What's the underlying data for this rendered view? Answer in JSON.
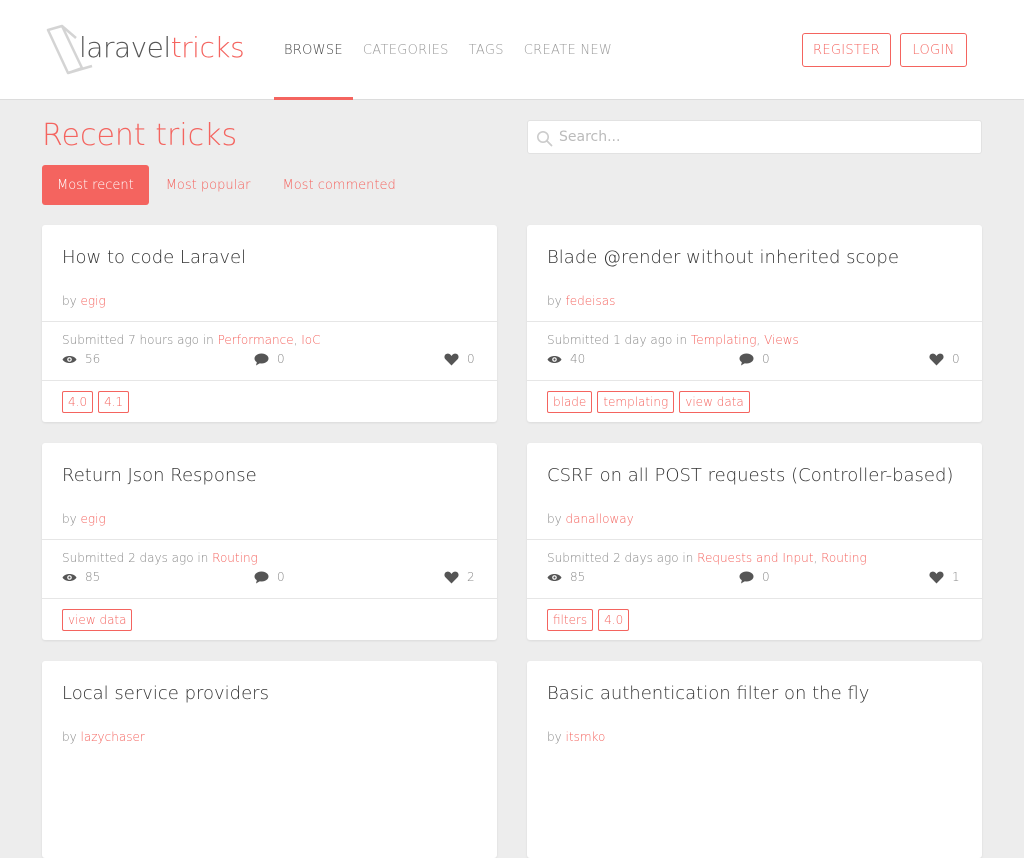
{
  "brand": {
    "part1": "laravel",
    "part2": "tricks",
    "accent": "#f4645f"
  },
  "nav": [
    {
      "label": "BROWSE",
      "active": true
    },
    {
      "label": "CATEGORIES"
    },
    {
      "label": "TAGS"
    },
    {
      "label": "CREATE NEW"
    }
  ],
  "auth": {
    "register": "REGISTER",
    "login": "LOGIN"
  },
  "page_title": "Recent tricks",
  "search": {
    "placeholder": "Search..."
  },
  "filters": [
    {
      "label": "Most recent",
      "active": true
    },
    {
      "label": "Most popular"
    },
    {
      "label": "Most commented"
    }
  ],
  "by_label": "by",
  "tricks": [
    {
      "title": "How to code Laravel",
      "author": "egig",
      "submitted": "Submitted 7 hours ago in",
      "categories": [
        "Performance",
        "IoC"
      ],
      "views": "56",
      "comments": "0",
      "likes": "0",
      "tags": [
        "4.0",
        "4.1"
      ]
    },
    {
      "title": "Blade @render without inherited scope",
      "author": "fedeisas",
      "submitted": "Submitted 1 day ago in",
      "categories": [
        "Templating",
        "Views"
      ],
      "views": "40",
      "comments": "0",
      "likes": "0",
      "tags": [
        "blade",
        "templating",
        "view data"
      ]
    },
    {
      "title": "Return Json Response",
      "author": "egig",
      "submitted": "Submitted 2 days ago in",
      "categories": [
        "Routing"
      ],
      "views": "85",
      "comments": "0",
      "likes": "2",
      "tags": [
        "view data"
      ]
    },
    {
      "title": "CSRF on all POST requests (Controller-based)",
      "author": "danalloway",
      "submitted": "Submitted 2 days ago in",
      "categories": [
        "Requests and Input",
        "Routing"
      ],
      "views": "85",
      "comments": "0",
      "likes": "1",
      "tags": [
        "filters",
        "4.0"
      ]
    },
    {
      "title": "Local service providers",
      "author": "lazychaser"
    },
    {
      "title": "Basic authentication filter on the fly",
      "author": "itsmko"
    }
  ]
}
